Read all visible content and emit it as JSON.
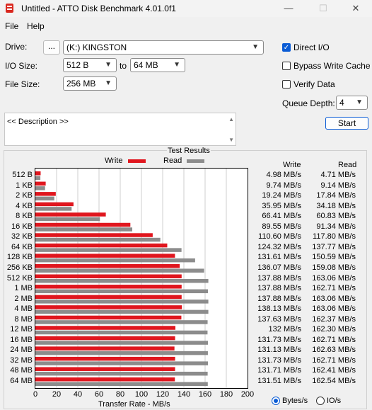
{
  "window": {
    "title": "Untitled - ATTO Disk Benchmark 4.01.0f1",
    "minimize": "—",
    "maximize": "☐",
    "close": "✕"
  },
  "menu": {
    "file": "File",
    "help": "Help"
  },
  "drive": {
    "label": "Drive:",
    "browse": "...",
    "value": "(K:) KINGSTON"
  },
  "io_size": {
    "label": "I/O Size:",
    "from": "512 B",
    "to_word": "to",
    "to": "64 MB"
  },
  "file_size": {
    "label": "File Size:",
    "value": "256 MB"
  },
  "options": {
    "direct_io": {
      "label": "Direct I/O",
      "checked": true
    },
    "bypass_write_cache": {
      "label": "Bypass Write Cache",
      "checked": false
    },
    "verify_data": {
      "label": "Verify Data",
      "checked": false
    }
  },
  "queue_depth": {
    "label": "Queue Depth:",
    "value": "4"
  },
  "start_button": "Start",
  "description": {
    "text": "<< Description >>"
  },
  "results": {
    "title": "Test Results",
    "legend_write": "Write",
    "legend_read": "Read",
    "col_write": "Write",
    "col_read": "Read",
    "write_color": "#e0161e",
    "read_color": "#8c8c8c",
    "rows": [
      {
        "size": "512 B",
        "write": "4.98 MB/s",
        "read": "4.71 MB/s"
      },
      {
        "size": "1 KB",
        "write": "9.74 MB/s",
        "read": "9.14 MB/s"
      },
      {
        "size": "2 KB",
        "write": "19.24 MB/s",
        "read": "17.84 MB/s"
      },
      {
        "size": "4 KB",
        "write": "35.95 MB/s",
        "read": "34.18 MB/s"
      },
      {
        "size": "8 KB",
        "write": "66.41 MB/s",
        "read": "60.83 MB/s"
      },
      {
        "size": "16 KB",
        "write": "89.55 MB/s",
        "read": "91.34 MB/s"
      },
      {
        "size": "32 KB",
        "write": "110.60 MB/s",
        "read": "117.80 MB/s"
      },
      {
        "size": "64 KB",
        "write": "124.32 MB/s",
        "read": "137.77 MB/s"
      },
      {
        "size": "128 KB",
        "write": "131.61 MB/s",
        "read": "150.59 MB/s"
      },
      {
        "size": "256 KB",
        "write": "136.07 MB/s",
        "read": "159.08 MB/s"
      },
      {
        "size": "512 KB",
        "write": "137.88 MB/s",
        "read": "163.06 MB/s"
      },
      {
        "size": "1 MB",
        "write": "137.88 MB/s",
        "read": "162.71 MB/s"
      },
      {
        "size": "2 MB",
        "write": "137.88 MB/s",
        "read": "163.06 MB/s"
      },
      {
        "size": "4 MB",
        "write": "138.13 MB/s",
        "read": "163.06 MB/s"
      },
      {
        "size": "8 MB",
        "write": "137.63 MB/s",
        "read": "162.37 MB/s"
      },
      {
        "size": "12 MB",
        "write": "132 MB/s",
        "read": "162.30 MB/s"
      },
      {
        "size": "16 MB",
        "write": "131.73 MB/s",
        "read": "162.71 MB/s"
      },
      {
        "size": "24 MB",
        "write": "131.13 MB/s",
        "read": "162.63 MB/s"
      },
      {
        "size": "32 MB",
        "write": "131.73 MB/s",
        "read": "162.71 MB/s"
      },
      {
        "size": "48 MB",
        "write": "131.71 MB/s",
        "read": "162.41 MB/s"
      },
      {
        "size": "64 MB",
        "write": "131.51 MB/s",
        "read": "162.54 MB/s"
      }
    ],
    "x_ticks": [
      "0",
      "20",
      "40",
      "60",
      "80",
      "100",
      "120",
      "140",
      "160",
      "180",
      "200"
    ],
    "x_label": "Transfer Rate - MB/s",
    "unit_bytes": "Bytes/s",
    "unit_io": "IO/s",
    "unit_selected": "Bytes/s"
  },
  "chart_data": {
    "type": "bar",
    "title": "Test Results",
    "xlabel": "Transfer Rate - MB/s",
    "ylabel": "",
    "xlim": [
      0,
      200
    ],
    "grid": true,
    "categories": [
      "512 B",
      "1 KB",
      "2 KB",
      "4 KB",
      "8 KB",
      "16 KB",
      "32 KB",
      "64 KB",
      "128 KB",
      "256 KB",
      "512 KB",
      "1 MB",
      "2 MB",
      "4 MB",
      "8 MB",
      "12 MB",
      "16 MB",
      "24 MB",
      "32 MB",
      "48 MB",
      "64 MB"
    ],
    "series": [
      {
        "name": "Write",
        "color": "#e0161e",
        "values": [
          4.98,
          9.74,
          19.24,
          35.95,
          66.41,
          89.55,
          110.6,
          124.32,
          131.61,
          136.07,
          137.88,
          137.88,
          137.88,
          138.13,
          137.63,
          132,
          131.73,
          131.13,
          131.73,
          131.71,
          131.51
        ]
      },
      {
        "name": "Read",
        "color": "#8c8c8c",
        "values": [
          4.71,
          9.14,
          17.84,
          34.18,
          60.83,
          91.34,
          117.8,
          137.77,
          150.59,
          159.08,
          163.06,
          162.71,
          163.06,
          163.06,
          162.37,
          162.3,
          162.71,
          162.63,
          162.71,
          162.41,
          162.54
        ]
      }
    ]
  }
}
